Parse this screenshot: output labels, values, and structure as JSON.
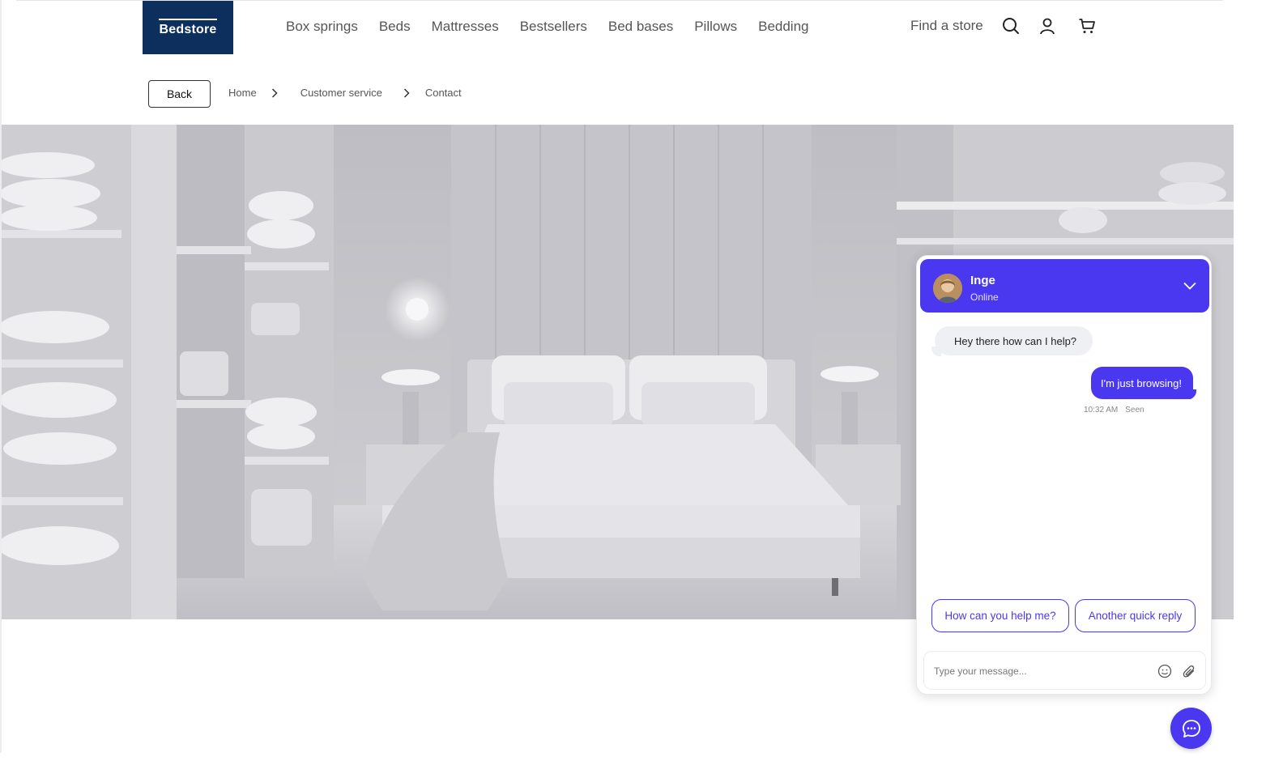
{
  "brand": {
    "logo_text": "Bedstore",
    "color": "#0d2f5e"
  },
  "nav": {
    "items": [
      "Box springs",
      "Beds",
      "Mattresses",
      "Bestsellers",
      "Bed bases",
      "Pillows",
      "Bedding"
    ]
  },
  "header": {
    "find_store_label": "Find a store",
    "icons": [
      "search-icon",
      "user-icon",
      "cart-icon"
    ]
  },
  "breadcrumb": {
    "back_label": "Back",
    "items": [
      "Home",
      "Customer service",
      "Contact"
    ]
  },
  "hero": {
    "description_icon": "bedroom-photo"
  },
  "chat": {
    "accent_color": "#4a38f0",
    "agent_name": "Inge",
    "agent_status": "Online",
    "messages": [
      {
        "from": "agent",
        "text": "Hey there how can I help?"
      },
      {
        "from": "user",
        "text": "I'm just browsing!",
        "time": "10:32 AM",
        "status": "Seen"
      }
    ],
    "quick_replies": [
      "How can you help me?",
      "Another quick reply"
    ],
    "input_placeholder": "Type your message...",
    "input_value": ""
  }
}
